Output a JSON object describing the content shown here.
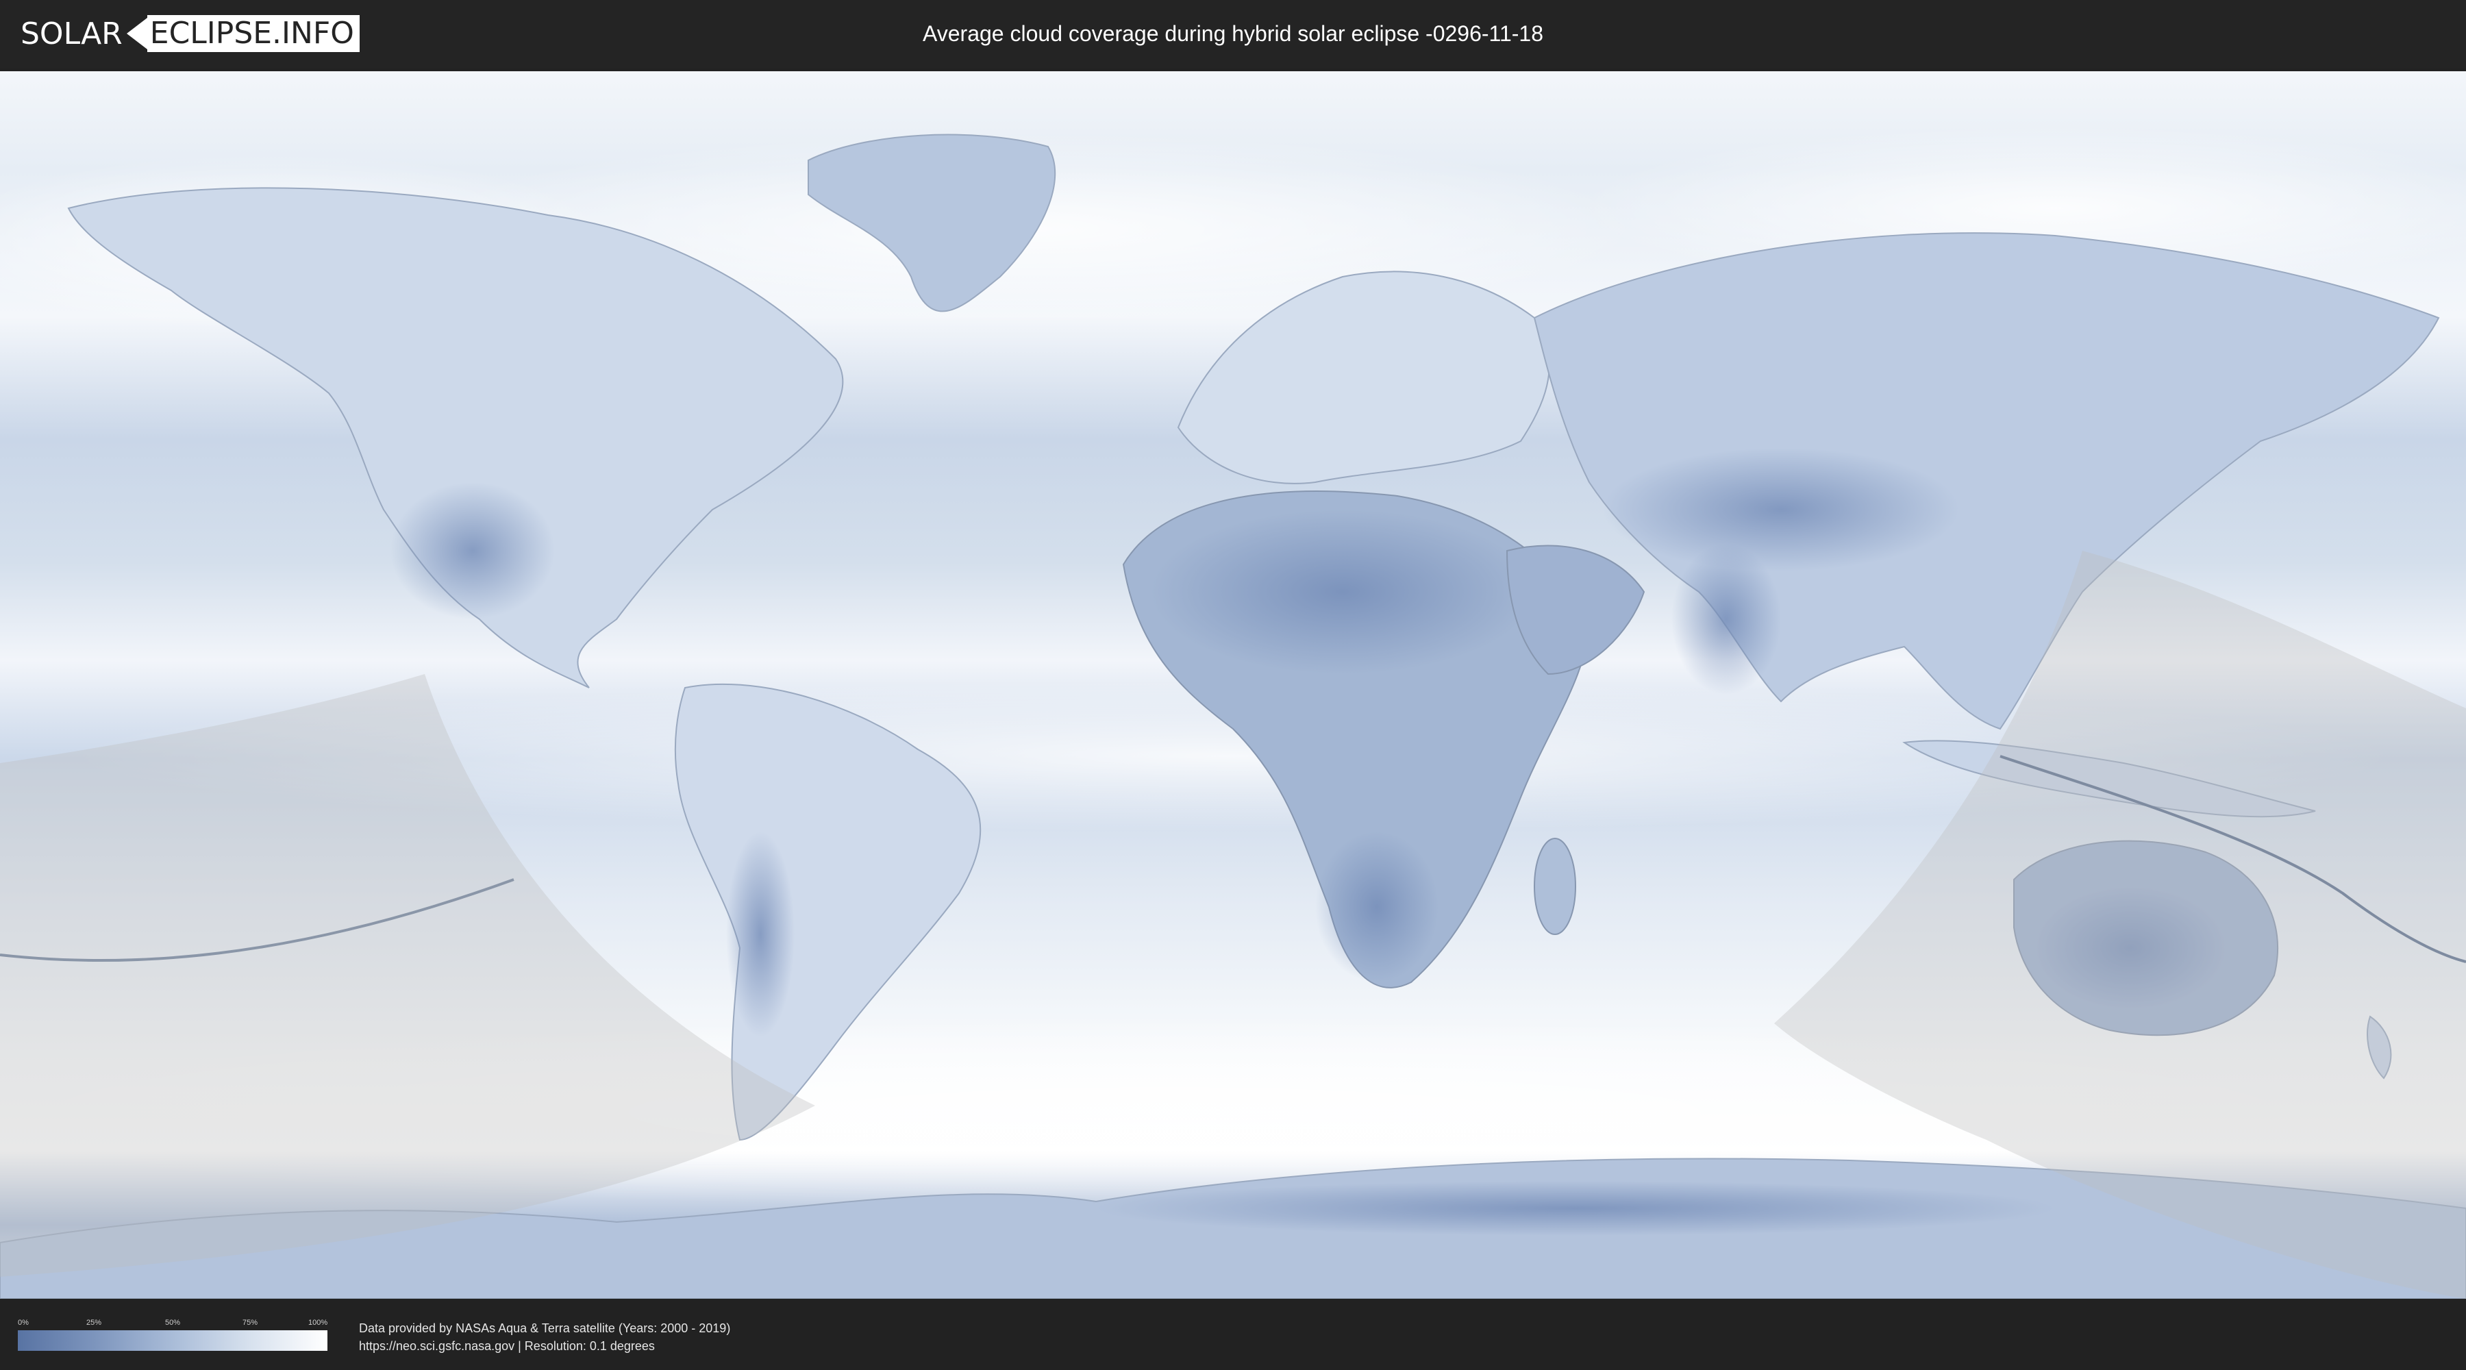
{
  "header": {
    "logo_left": "SOLAR",
    "logo_right": "ECLIPSE.INFO",
    "title": "Average cloud coverage during hybrid solar eclipse -0296-11-18"
  },
  "legend": {
    "ticks": [
      "0%",
      "25%",
      "50%",
      "75%",
      "100%"
    ],
    "gradient_colors": [
      "#5873a3",
      "#7d95bd",
      "#a9bcd8",
      "#d7e1ee",
      "#ffffff"
    ]
  },
  "credits": {
    "line1": "Data provided by NASAs Aqua & Terra satellite (Years: 2000 - 2019)",
    "line2": "https://neo.sci.gsfc.nasa.gov | Resolution: 0.1 degrees"
  },
  "colors": {
    "ocean_cloud": "#dde6f1",
    "clear_sky": "#6f88b5",
    "cloudy": "#ffffff",
    "eclipse_shade": "#bfbfbf"
  }
}
